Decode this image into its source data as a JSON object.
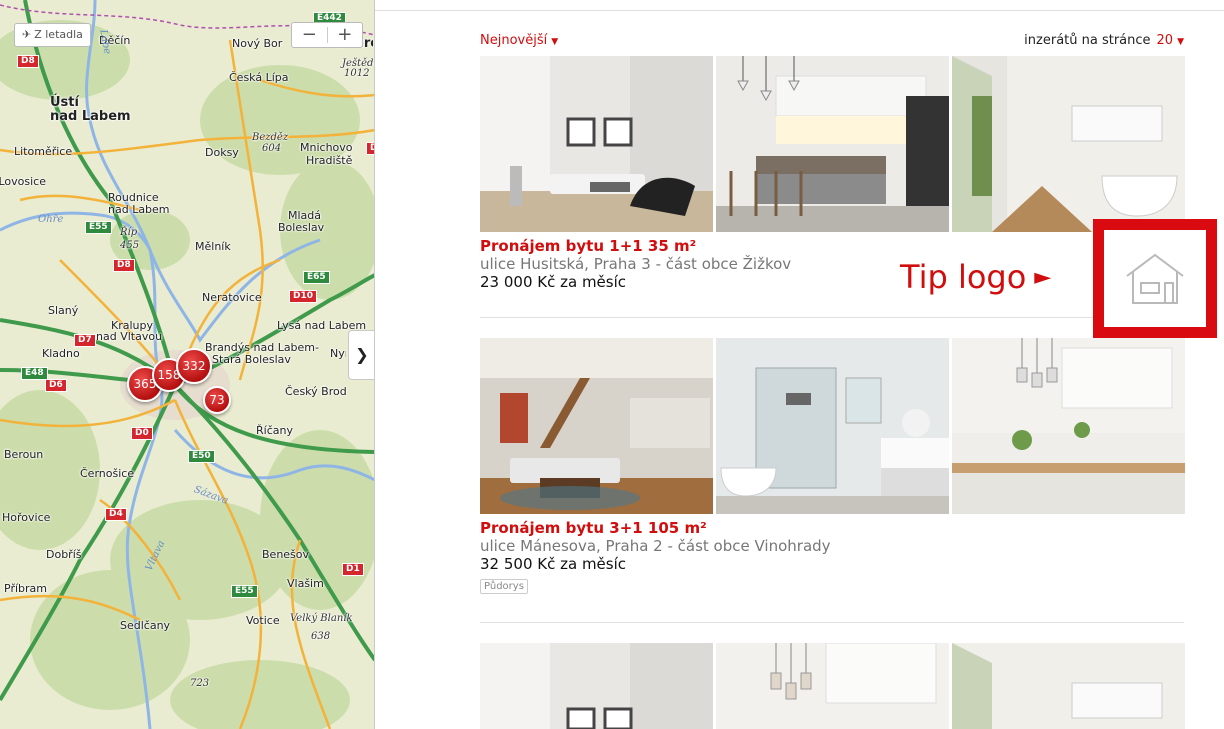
{
  "map": {
    "aerial_label": "Z letadla",
    "zoom_out": "−",
    "zoom_in": "+",
    "expand_arrow": "❯",
    "places": [
      {
        "name": "Děčín",
        "cls": ""
      },
      {
        "name": "Nový Bor",
        "cls": ""
      },
      {
        "name": "Česká Lípa",
        "cls": ""
      },
      {
        "name": "Ústí",
        "cls": "big"
      },
      {
        "name": "nad Labem",
        "cls": "big"
      },
      {
        "name": "Litoměřice",
        "cls": ""
      },
      {
        "name": "Doksy",
        "cls": ""
      },
      {
        "name": "Mnichovo",
        "cls": ""
      },
      {
        "name": "Hradiště",
        "cls": ""
      },
      {
        "name": "Roudnice",
        "cls": ""
      },
      {
        "name": "nad Labem",
        "cls": ""
      },
      {
        "name": "Mladá",
        "cls": ""
      },
      {
        "name": "Boleslav",
        "cls": ""
      },
      {
        "name": "Mělník",
        "cls": ""
      },
      {
        "name": "Neratovice",
        "cls": ""
      },
      {
        "name": "Slaný",
        "cls": ""
      },
      {
        "name": "Kralupy",
        "cls": ""
      },
      {
        "name": "nad Vltavou",
        "cls": ""
      },
      {
        "name": "Lysá nad Labem",
        "cls": ""
      },
      {
        "name": "Kladno",
        "cls": ""
      },
      {
        "name": "Brandýs nad Labem-",
        "cls": ""
      },
      {
        "name": "Stará Boleslav",
        "cls": ""
      },
      {
        "name": "Český Brod",
        "cls": ""
      },
      {
        "name": "Říčany",
        "cls": ""
      },
      {
        "name": "Beroun",
        "cls": ""
      },
      {
        "name": "Černošice",
        "cls": ""
      },
      {
        "name": "Hořovice",
        "cls": ""
      },
      {
        "name": "Dobříš",
        "cls": ""
      },
      {
        "name": "Benešov",
        "cls": ""
      },
      {
        "name": "Příbram",
        "cls": ""
      },
      {
        "name": "Vlašim",
        "cls": ""
      },
      {
        "name": "Sedlčany",
        "cls": ""
      },
      {
        "name": "Votice",
        "cls": ""
      },
      {
        "name": "Nymburk",
        "cls": ""
      },
      {
        "name": "Liberec",
        "cls": "big"
      },
      {
        "name": "Lovosice",
        "cls": ""
      }
    ],
    "peaks": [
      "Ještěd",
      "1012",
      "Bezděz",
      "604",
      "Říp",
      "455",
      "Velký Blaník",
      "638",
      "723"
    ],
    "rivers": [
      "Labe",
      "Ohře",
      "Vltava",
      "Sázava"
    ],
    "roads": [
      "D8",
      "D8",
      "D8",
      "E55",
      "E65",
      "D10",
      "D7",
      "E48",
      "D6",
      "D0",
      "E50",
      "D4",
      "D1",
      "E55",
      "E442",
      "D10"
    ],
    "clusters": [
      "365",
      "158",
      "332",
      "73"
    ]
  },
  "results": {
    "sort_label": "Nejnovější",
    "per_page_label": "inzerátů na stránce",
    "per_page_value": "20",
    "listings": [
      {
        "title": "Pronájem bytu 1+1 35 m²",
        "address": "ulice Husitská, Praha 3 - část obce Žižkov",
        "price": "23 000 Kč za měsíc",
        "tag": ""
      },
      {
        "title": "Pronájem bytu 3+1 105 m²",
        "address": "ulice Mánesova, Praha 2 - část obce Vinohrady",
        "price": "32 500 Kč za měsíc",
        "tag": "Půdorys"
      }
    ]
  },
  "callout": {
    "text": "Tip logo",
    "arrow": "►",
    "accent": "#d90a10"
  },
  "colors": {
    "accent": "#d10d0d",
    "map_bg": "#e9ecd0",
    "cluster": "#c81414"
  }
}
